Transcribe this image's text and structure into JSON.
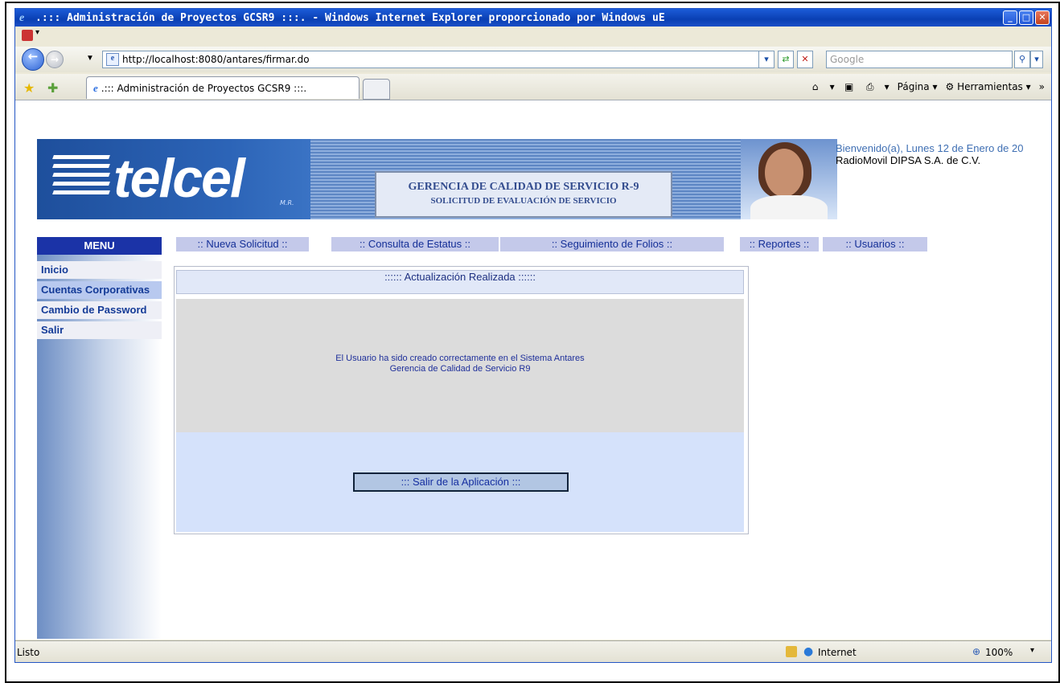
{
  "window": {
    "title": ".::: Administración de Proyectos GCSR9 :::. - Windows Internet Explorer proporcionado por Windows uE"
  },
  "toolbar": {
    "url": "http://localhost:8080/antares/firmar.do",
    "search_placeholder": "Google",
    "tab_title": ".::: Administración de Proyectos GCSR9 :::.",
    "pagina_label": "Página",
    "herramientas_label": "Herramientas"
  },
  "banner": {
    "logo_text": "telcel",
    "logo_mark": "M.R.",
    "title_line1": "GERENCIA DE CALIDAD DE SERVICIO R-9",
    "title_line2": "SOLICITUD DE EVALUACIÓN DE SERVICIO",
    "welcome_line1": "Bienvenido(a), Lunes 12 de Enero de 20",
    "welcome_line2": "RadioMovil DIPSA S.A. de C.V."
  },
  "sidebar": {
    "header": "MENU",
    "items": [
      {
        "label": "Inicio"
      },
      {
        "label": "Cuentas Corporativas",
        "selected": true
      },
      {
        "label": "Cambio de Password"
      },
      {
        "label": "Salir"
      }
    ]
  },
  "nav": [
    {
      "label": ":: Nueva Solicitud ::"
    },
    {
      "label": ":: Consulta de Estatus ::"
    },
    {
      "label": ":: Seguimiento de Folios ::"
    },
    {
      "label": ":: Reportes ::"
    },
    {
      "label": ":: Usuarios ::"
    }
  ],
  "main": {
    "header": ":::::: Actualización Realizada ::::::",
    "message_line1": "El Usuario ha sido creado correctamente en el Sistema Antares",
    "message_line2": "Gerencia de Calidad de Servicio R9",
    "exit_button": "::: Salir de la Aplicación :::"
  },
  "status": {
    "text": "Listo",
    "zone": "Internet",
    "zoom": "100%"
  },
  "colors": {
    "menu_header": "#1b33a7",
    "nav_tab": "#c4c9ea",
    "link_text": "#143b97"
  }
}
